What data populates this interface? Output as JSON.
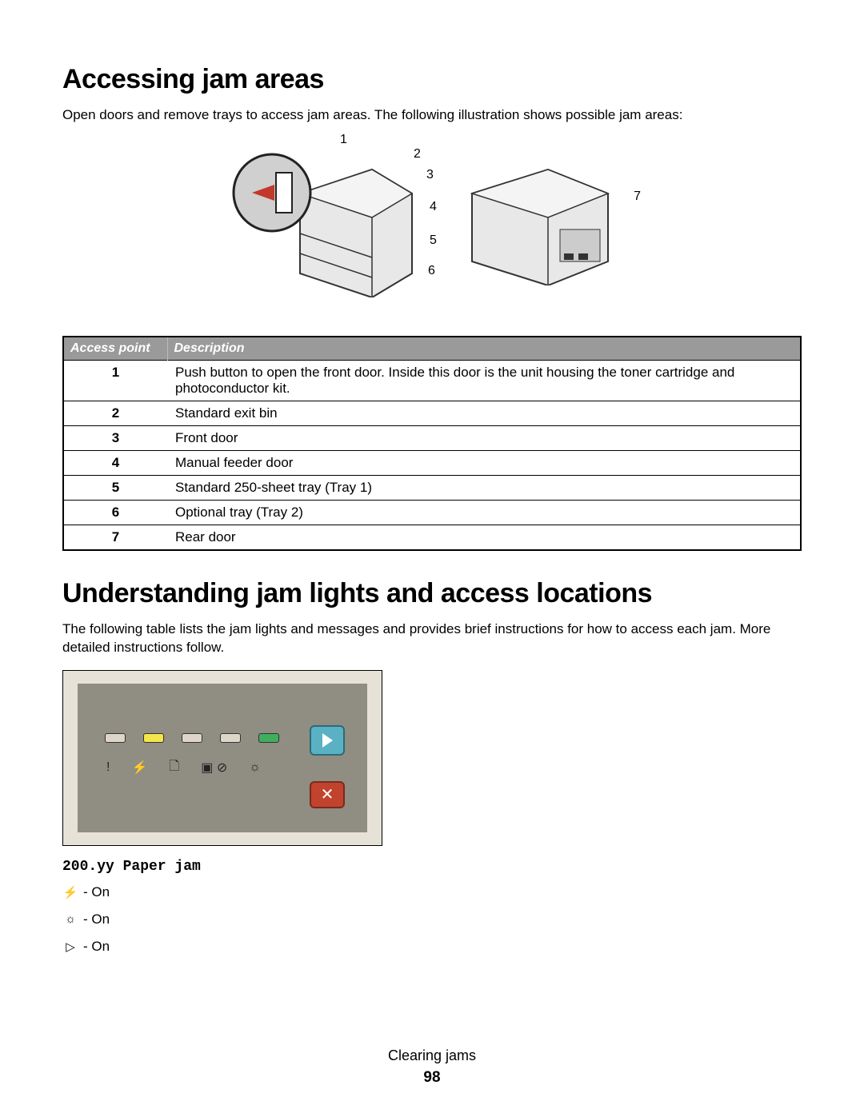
{
  "section1": {
    "heading": "Accessing jam areas",
    "intro": "Open doors and remove trays to access jam areas. The following illustration shows possible jam areas:"
  },
  "callouts": [
    "1",
    "2",
    "3",
    "4",
    "5",
    "6",
    "7"
  ],
  "table": {
    "headers": {
      "col1": "Access point",
      "col2": "Description"
    },
    "rows": [
      {
        "n": "1",
        "d": "Push button to open the front door. Inside this door is the unit housing the toner cartridge and photoconductor kit."
      },
      {
        "n": "2",
        "d": "Standard exit bin"
      },
      {
        "n": "3",
        "d": "Front door"
      },
      {
        "n": "4",
        "d": "Manual feeder door"
      },
      {
        "n": "5",
        "d": "Standard 250-sheet tray (Tray 1)"
      },
      {
        "n": "6",
        "d": "Optional tray (Tray 2)"
      },
      {
        "n": "7",
        "d": "Rear door"
      }
    ]
  },
  "section2": {
    "heading": "Understanding jam lights and access locations",
    "intro": "The following table lists the jam lights and messages and provides brief instructions for how to access each jam. More detailed instructions follow."
  },
  "panel_icons": {
    "i1": "!",
    "i2": "⚡",
    "i3": "🗋",
    "i4": "▣ ⊘",
    "i5": "☼"
  },
  "jam": {
    "code": "200.yy Paper jam",
    "lines": [
      {
        "icon": "⚡",
        "text": " - On"
      },
      {
        "icon": "☼",
        "text": " - On"
      },
      {
        "icon": "▷",
        "text": " - On"
      }
    ]
  },
  "footer": {
    "label": "Clearing jams",
    "page": "98"
  }
}
